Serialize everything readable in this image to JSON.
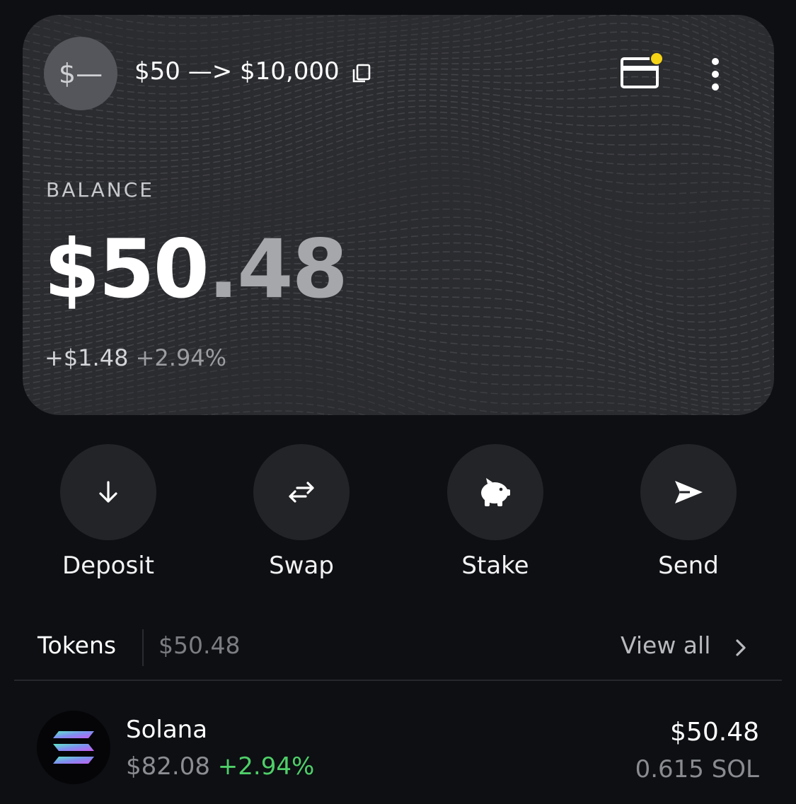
{
  "wallet": {
    "avatar_text": "$—",
    "name": "$50 —> $10,000",
    "balance_label": "BALANCE",
    "balance_main": "$50",
    "balance_cents": ".48",
    "change_abs": "+$1.48",
    "change_pct": "+2.94%",
    "notification_color": "#f5d316"
  },
  "actions": [
    {
      "label": "Deposit",
      "icon": "arrow-down-icon"
    },
    {
      "label": "Swap",
      "icon": "swap-arrows-icon"
    },
    {
      "label": "Stake",
      "icon": "piggy-bank-icon"
    },
    {
      "label": "Send",
      "icon": "send-icon"
    }
  ],
  "tokens": {
    "title": "Tokens",
    "total": "$50.48",
    "view_all": "View all",
    "items": [
      {
        "name": "Solana",
        "price": "$82.08",
        "change": "+2.94%",
        "value": "$50.48",
        "amount": "0.615 SOL",
        "icon": "solana-logo-icon"
      }
    ]
  },
  "colors": {
    "background": "#0d0f13",
    "card": "#2b2c30",
    "positive": "#4fcf68",
    "muted": "#8c8d92"
  }
}
